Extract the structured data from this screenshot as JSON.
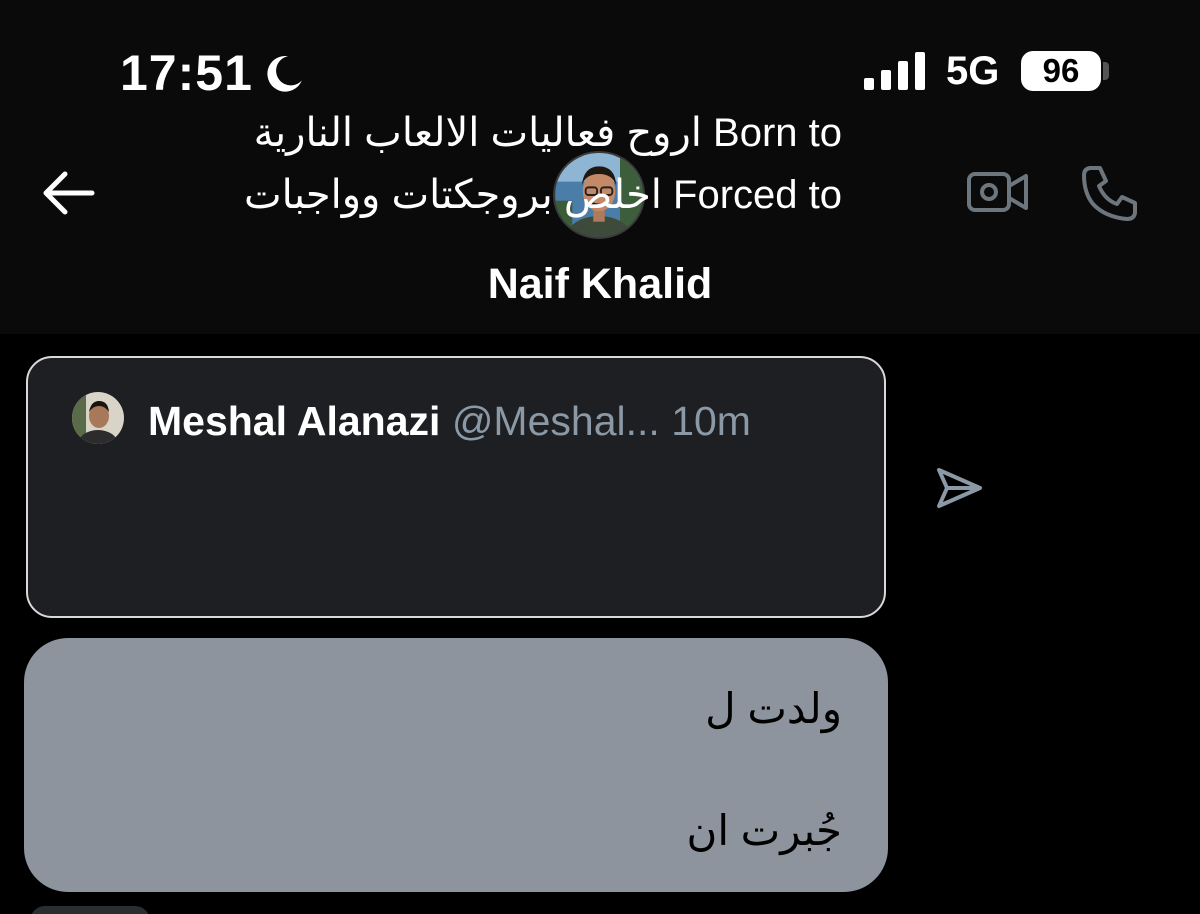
{
  "status_bar": {
    "time": "17:51",
    "focus_icon": "moon-icon",
    "signal_icon": "cellular-signal-icon",
    "network": "5G",
    "battery": "96"
  },
  "header": {
    "back_icon": "arrow-left-icon",
    "contact_name": "Naif Khalid",
    "video_icon": "video-camera-icon",
    "phone_icon": "phone-icon"
  },
  "shared_tweet": {
    "author_name": "Meshal Alanazi",
    "author_handle": "@Meshal...",
    "time": "10m",
    "line1": "Born to اروح فعاليات الالعاب النارية",
    "line2": "Forced to  اخلص بروجكتات وواجبات",
    "share_icon": "send-icon"
  },
  "message": {
    "line1": "ولدت ل",
    "line2": "جُبرت ان"
  },
  "colors": {
    "background": "#000000",
    "header_background": "#0a0a0a",
    "card_background": "#1d1f23",
    "bubble_background": "#8d949d",
    "secondary_text": "#8b98a5"
  }
}
